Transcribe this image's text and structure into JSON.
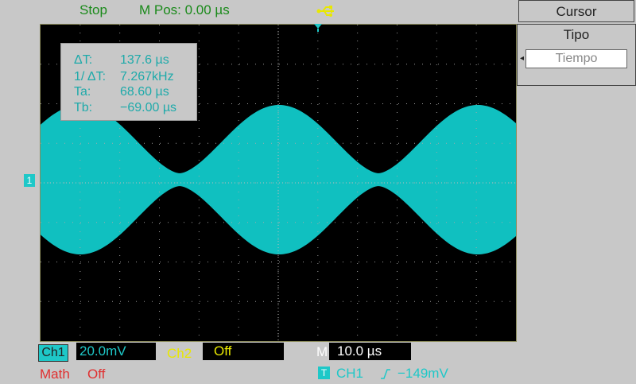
{
  "status": {
    "run_state": "Stop",
    "run_state_color": "#1a8a1a",
    "mpos_label": "M Pos: 0.00 µs",
    "mpos_color": "#1a8a1a",
    "usb_icon": "usb-icon",
    "usb_color": "#e8e800"
  },
  "cursor_readout": {
    "delta_t_label": "ΔT:",
    "delta_t_value": "137.6 µs",
    "inv_delta_t_label": "1/ ΔT:",
    "inv_delta_t_value": "7.267kHz",
    "ta_label": "Ta:",
    "ta_value": "68.60 µs",
    "tb_label": "Tb:",
    "tb_value": "−69.00 µs"
  },
  "menu": {
    "title": "Cursor",
    "item_label": "Tipo",
    "item_value": "Tiempo"
  },
  "channels": {
    "ch1_label": "Ch1",
    "ch1_scale": "20.0mV",
    "ch1_color": "#1ec8c8",
    "ch2_label": "Ch2",
    "ch2_scale": "Off",
    "ch2_color": "#e8e800",
    "math_label": "Math",
    "math_value": "Off",
    "math_color": "#e03030",
    "ch_marker": "1"
  },
  "timebase": {
    "label": "M",
    "value": "10.0 µs"
  },
  "trigger": {
    "badge": "T",
    "source": "CH1",
    "edge_icon": "rising-edge-icon",
    "level": "−149mV"
  },
  "waveform": {
    "color": "#10c0c0",
    "description_type": "AM envelope"
  }
}
